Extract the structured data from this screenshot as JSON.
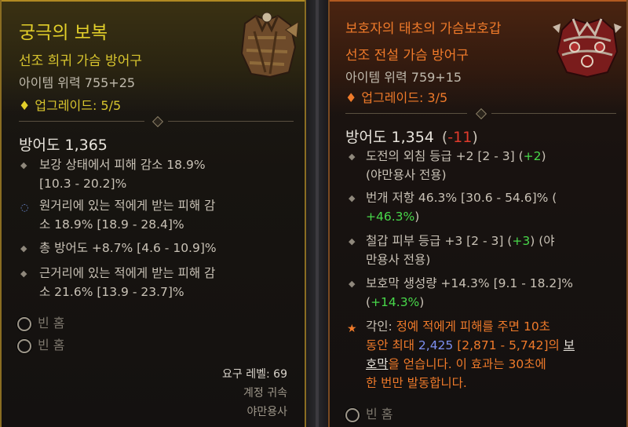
{
  "left": {
    "title": "궁극의 보복",
    "subtitle": "선조 희귀 가슴 방어구",
    "item_power": "아이템 위력 755+25",
    "upgrade_label": "업그레이드: 5/5",
    "armor": "방어도 1,365",
    "affixes": [
      [
        "보강 상태에서 피해 감소 18.9%",
        "[10.3 - 20.2]%"
      ],
      [
        "원거리에 있는 적에게 받는 피해 감",
        "소 18.9% [18.9 - 28.4]%"
      ],
      [
        "총 방어도 +8.7% [4.6 - 10.9]%"
      ],
      [
        "근거리에 있는 적에게 받는 피해 감",
        "소 21.6% [13.9 - 23.7]%"
      ]
    ],
    "sockets": [
      "빈 홈",
      "빈 홈"
    ],
    "requirement": "요구 레벨: 69",
    "bound": "계정 귀속",
    "class_req": "야만용사"
  },
  "right": {
    "title": "보호자의 태초의 가슴보호갑",
    "subtitle": "선조 전설 가슴 방어구",
    "item_power": "아이템 위력 759+15",
    "upgrade_label": "업그레이드: 3/5",
    "armor": "방어도 1,354",
    "armor_delta": "-11",
    "affix1_a": "도전의 외침 등급 +2 [2 - 3] (",
    "affix1_green": "+2",
    "affix1_b": ")",
    "affix1_line2": "(야만용사 전용)",
    "affix2_line1": "번개 저항 46.3% [30.6 - 54.6]% (",
    "affix2_green": "+46.3%",
    "affix2_b": ")",
    "affix3_a": "철갑 피부 등급 +3 [2 - 3] (",
    "affix3_green": "+3",
    "affix3_b": ") (야",
    "affix3_line2": "만용사 전용)",
    "affix4_line1": "보호막 생성량 +14.3% [9.1 - 18.2]%",
    "affix4_open": "(",
    "affix4_green": "+14.3%",
    "affix4_close": ")",
    "aspect_label": "각인: ",
    "aspect_l1": "정예 적에게 피해를 주면 10초",
    "aspect_l2a": "동안 최대 ",
    "aspect_l2_value": "2,425",
    "aspect_l2b": " [2,871 - 5,742]의 ",
    "aspect_l2_link": "보",
    "aspect_l3_link": "호막",
    "aspect_l3b": "을 얻습니다. 이 효과는 30초에",
    "aspect_l4": "한 번만 발동합니다.",
    "socket": "빈 홈"
  },
  "colors": {
    "rare": "#e2cf2a",
    "legendary": "#ef7a2a",
    "bonus_green": "#48d84a",
    "penalty_red": "#e03a2c",
    "value_blue": "#7d8ff0"
  },
  "icons": {
    "left_item": "tattered-leather-chest-armor-icon",
    "right_item": "red-plated-chest-armor-icon",
    "upgrade": "diamond-icon",
    "aspect": "star-icon",
    "socket": "empty-socket-icon"
  }
}
